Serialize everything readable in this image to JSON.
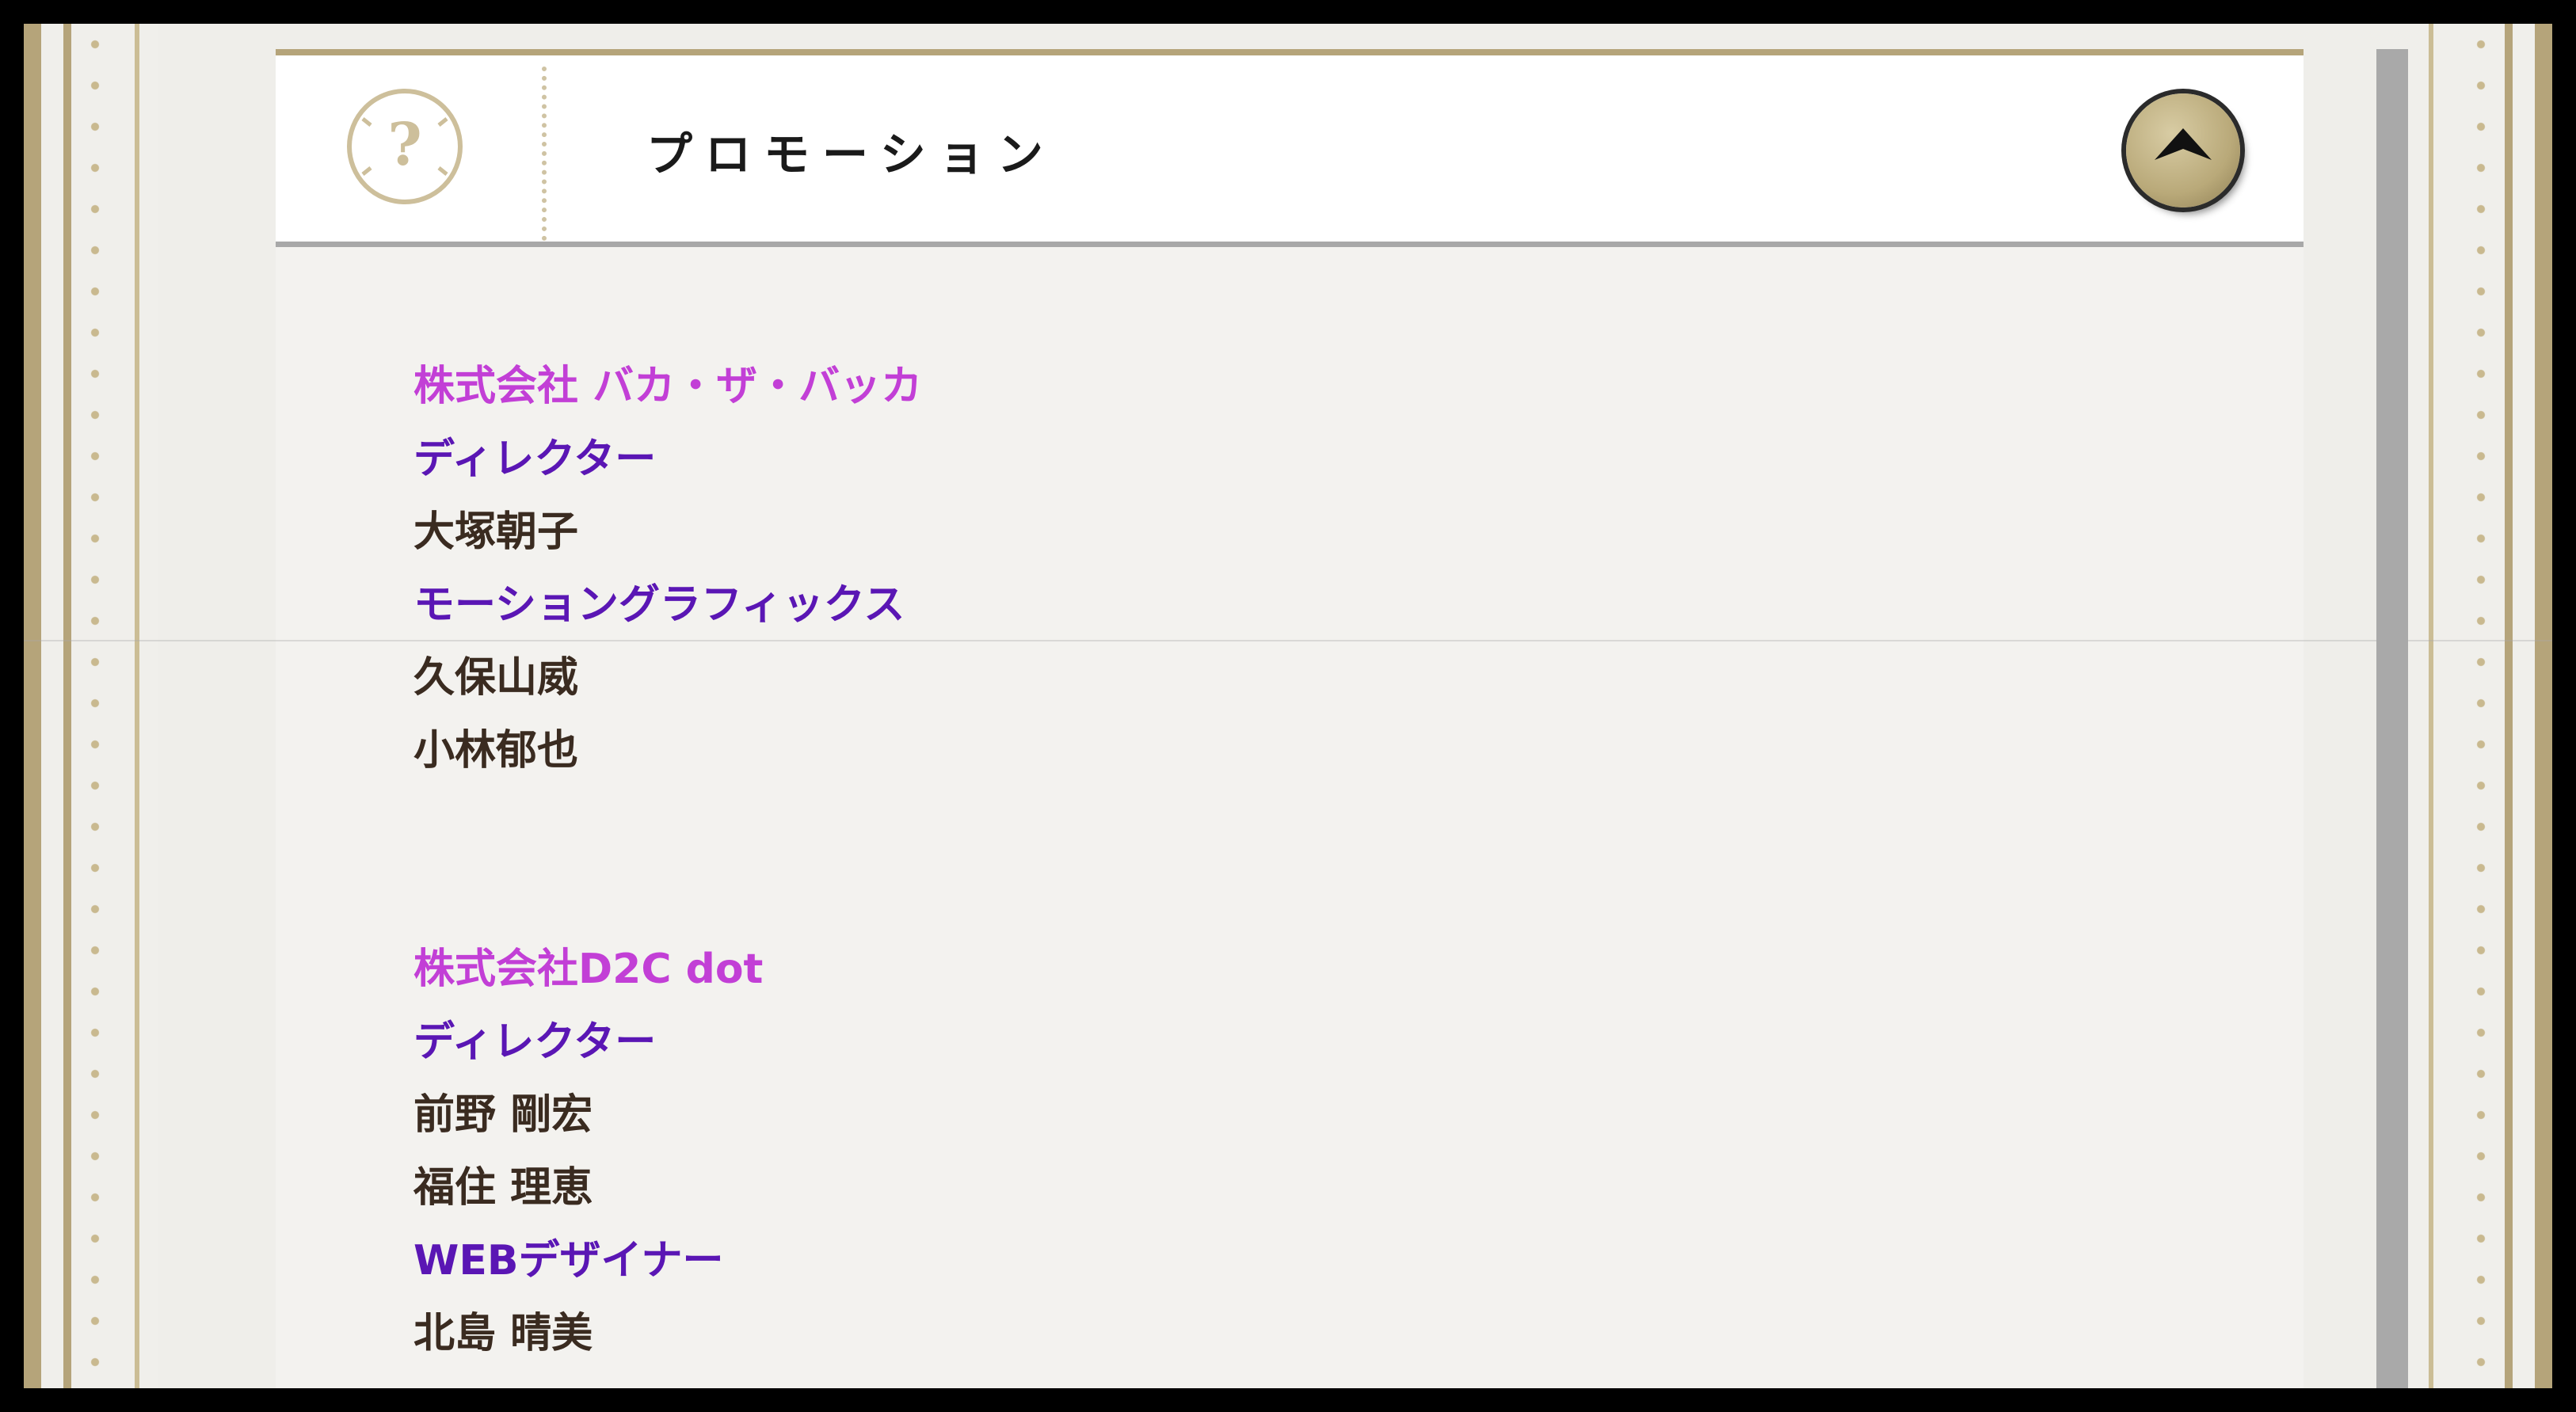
{
  "header": {
    "title": "プロモーション",
    "help_icon": "question-mark-icon",
    "collapse_icon": "chevron-up-icon"
  },
  "credits": [
    {
      "company": "株式会社 バカ・ザ・バッカ",
      "lines": [
        {
          "type": "role",
          "text": "ディレクター"
        },
        {
          "type": "person",
          "text": "大塚朝子"
        },
        {
          "type": "role",
          "text": "モーショングラフィックス"
        },
        {
          "type": "person",
          "text": "久保山威"
        },
        {
          "type": "person",
          "text": "小林郁也"
        }
      ]
    },
    {
      "company": "株式会社D2C dot",
      "lines": [
        {
          "type": "role",
          "text": "ディレクター"
        },
        {
          "type": "person",
          "text": "前野 剛宏"
        },
        {
          "type": "person",
          "text": "福住 理恵"
        },
        {
          "type": "role",
          "text": "WEBデザイナー"
        },
        {
          "type": "person",
          "text": "北島 晴美"
        }
      ]
    }
  ],
  "colors": {
    "company": "#c23fd6",
    "role": "#5a16b4",
    "person": "#3a2b20",
    "gold": "#b5a47a"
  }
}
